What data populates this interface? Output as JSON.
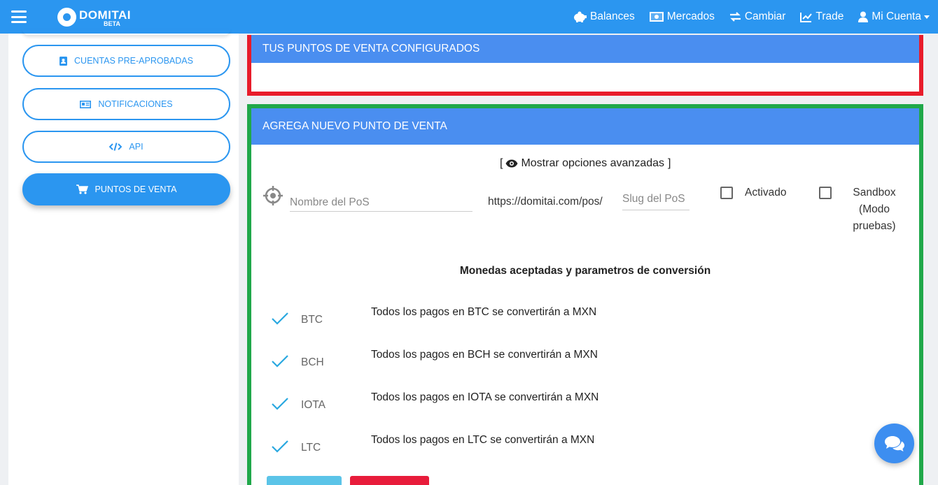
{
  "navbar": {
    "logo_text": "DOMITAI",
    "logo_badge": "BETA",
    "links": [
      {
        "label": "Balances",
        "icon": "piggy-bank-icon"
      },
      {
        "label": "Mercados",
        "icon": "money-bill-icon"
      },
      {
        "label": "Cambiar",
        "icon": "exchange-icon"
      },
      {
        "label": "Trade",
        "icon": "chart-line-icon"
      },
      {
        "label": "Mi Cuenta",
        "icon": "user-icon"
      }
    ]
  },
  "sidebar": {
    "items": [
      {
        "label": "CUENTAS PRE-APROBADAS",
        "icon": "address-book-icon",
        "active": false
      },
      {
        "label": "NOTIFICACIONES",
        "icon": "newspaper-icon",
        "active": false
      },
      {
        "label": "API",
        "icon": "code-icon",
        "active": false
      },
      {
        "label": "PUNTOS DE VENTA",
        "icon": "cart-icon",
        "active": true
      }
    ]
  },
  "configured_panel": {
    "title": "TUS PUNTOS DE VENTA CONFIGURADOS"
  },
  "new_pos_panel": {
    "title": "AGREGA NUEVO PUNTO DE VENTA",
    "advanced_toggle": {
      "open_bracket": "[",
      "label": "Mostrar opciones avanzadas",
      "close_bracket": "]"
    },
    "name_placeholder": "Nombre del PoS",
    "url_prefix": "https://domitai.com/pos/",
    "slug_placeholder": "Slug del PoS",
    "activated_label": "Activado",
    "sandbox_label": "Sandbox (Modo pruebas)",
    "sandbox_line1": "Sandbox",
    "sandbox_line2": "(Modo",
    "sandbox_line3": "pruebas)",
    "currencies_title": "Monedas aceptadas y parametros de conversión",
    "currencies": [
      {
        "code": "BTC",
        "description": "Todos los pagos en BTC se convertirán a MXN"
      },
      {
        "code": "BCH",
        "description": "Todos los pagos en BCH se convertirán a MXN"
      },
      {
        "code": "IOTA",
        "description": "Todos los pagos en IOTA se convertirán a MXN"
      },
      {
        "code": "LTC",
        "description": "Todos los pagos en LTC se convertirán a MXN"
      }
    ]
  },
  "colors": {
    "primary": "#2b96f0",
    "panel_header": "#4a8ef0",
    "highlight_red": "#e81c2b",
    "highlight_green": "#20a84a"
  }
}
